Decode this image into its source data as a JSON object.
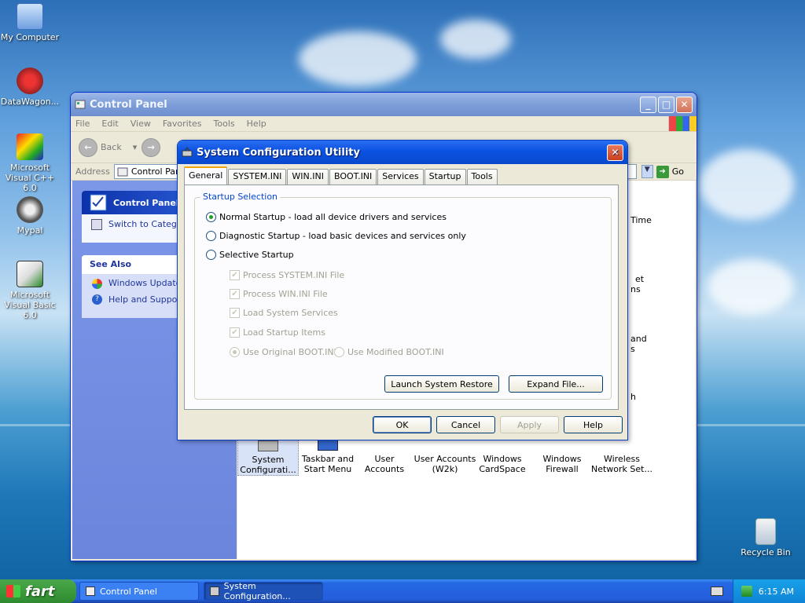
{
  "desktop": {
    "icons": [
      {
        "label": "My Computer"
      },
      {
        "label": "DataWagon..."
      },
      {
        "label": "Microsoft Visual C++ 6.0"
      },
      {
        "label": "Mypal"
      },
      {
        "label": "Microsoft Visual Basic 6.0"
      },
      {
        "label": "Recycle Bin"
      }
    ]
  },
  "control_panel": {
    "title": "Control Panel",
    "menu": [
      "File",
      "Edit",
      "View",
      "Favorites",
      "Tools",
      "Help"
    ],
    "back_label": "Back",
    "address_label": "Address",
    "address_value": "Control Panel",
    "go_label": "Go",
    "panel_title": "Control Panel",
    "switch_link": "Switch to Category View",
    "see_also_title": "See Also",
    "see_also_links": [
      "Windows Update",
      "Help and Support"
    ],
    "right_fragments": [
      "Time",
      "et",
      "ns",
      "and",
      "s",
      "h"
    ],
    "icons": [
      {
        "label": "System Configurati..."
      },
      {
        "label": "Taskbar and Start Menu"
      },
      {
        "label": "User Accounts"
      },
      {
        "label": "User Accounts (W2k)"
      },
      {
        "label": "Windows CardSpace"
      },
      {
        "label": "Windows Firewall"
      },
      {
        "label": "Wireless Network Set..."
      }
    ]
  },
  "sysconfig": {
    "title": "System Configuration Utility",
    "tabs": [
      "General",
      "SYSTEM.INI",
      "WIN.INI",
      "BOOT.INI",
      "Services",
      "Startup",
      "Tools"
    ],
    "group_title": "Startup Selection",
    "radios": [
      {
        "label": "Normal Startup - load all device drivers and services",
        "selected": true
      },
      {
        "label": "Diagnostic Startup - load basic devices and services only",
        "selected": false
      },
      {
        "label": "Selective Startup",
        "selected": false
      }
    ],
    "checks": [
      {
        "label": "Process SYSTEM.INI File",
        "checked": true
      },
      {
        "label": "Process WIN.INI File",
        "checked": true
      },
      {
        "label": "Load System Services",
        "checked": true
      },
      {
        "label": "Load Startup Items",
        "checked": true
      }
    ],
    "boot_options": [
      {
        "label": "Use Original BOOT.INI",
        "selected": true
      },
      {
        "label": "Use Modified BOOT.INI",
        "selected": false
      }
    ],
    "launch_restore": "Launch System Restore",
    "expand_file": "Expand File...",
    "buttons": {
      "ok": "OK",
      "cancel": "Cancel",
      "apply": "Apply",
      "help": "Help"
    }
  },
  "taskbar": {
    "start_label": "fart",
    "items": [
      {
        "label": "Control Panel"
      },
      {
        "label": "System Configuration..."
      }
    ],
    "clock": "6:15 AM"
  }
}
